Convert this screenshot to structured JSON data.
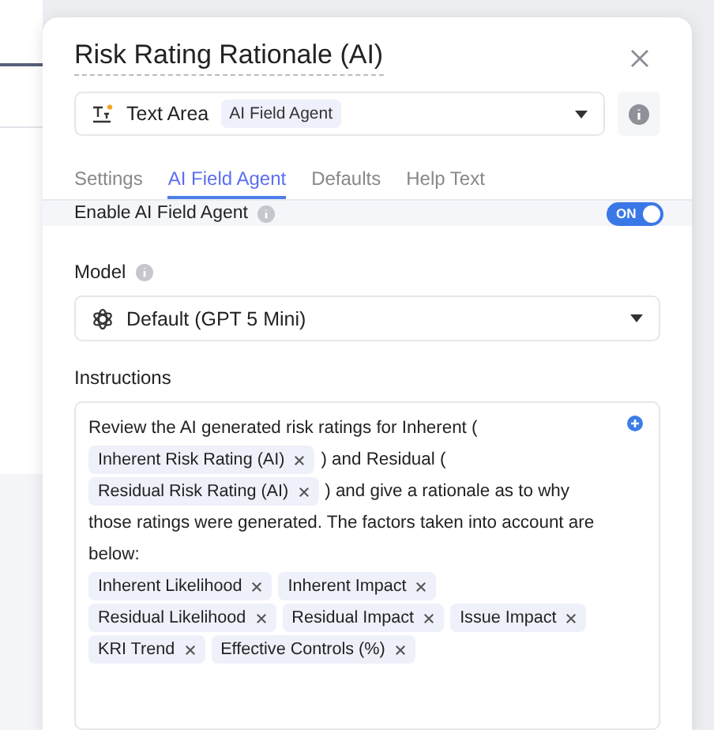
{
  "dialog": {
    "title": "Risk Rating Rationale (AI)",
    "field_type": {
      "label": "Text Area",
      "badge": "AI Field Agent"
    }
  },
  "tabs": [
    {
      "label": "Settings",
      "selected": false
    },
    {
      "label": "AI Field Agent",
      "selected": true
    },
    {
      "label": "Defaults",
      "selected": false
    },
    {
      "label": "Help Text",
      "selected": false
    }
  ],
  "enable_row": {
    "label": "Enable AI Field Agent",
    "toggle_text": "ON",
    "on": true
  },
  "model": {
    "label": "Model",
    "value": "Default (GPT 5 Mini)"
  },
  "instructions": {
    "label": "Instructions",
    "segments": [
      {
        "kind": "text",
        "text": "Review the AI generated risk ratings for Inherent ("
      },
      {
        "kind": "break"
      },
      {
        "kind": "chip",
        "text": "Inherent Risk Rating (AI)"
      },
      {
        "kind": "text",
        "text": ") and Residual ("
      },
      {
        "kind": "break"
      },
      {
        "kind": "chip",
        "text": "Residual Risk Rating (AI)"
      },
      {
        "kind": "text",
        "text": ") and give a rationale as to why"
      },
      {
        "kind": "break"
      },
      {
        "kind": "text",
        "text": "those ratings were generated. The factors taken into account are"
      },
      {
        "kind": "break"
      },
      {
        "kind": "text",
        "text": "below:"
      },
      {
        "kind": "break"
      },
      {
        "kind": "chip",
        "text": "Inherent Likelihood"
      },
      {
        "kind": "chip",
        "text": "Inherent Impact"
      },
      {
        "kind": "break"
      },
      {
        "kind": "chip",
        "text": "Residual Likelihood"
      },
      {
        "kind": "chip",
        "text": "Residual Impact"
      },
      {
        "kind": "chip",
        "text": "Issue Impact"
      },
      {
        "kind": "break"
      },
      {
        "kind": "chip",
        "text": "KRI Trend"
      },
      {
        "kind": "chip",
        "text": "Effective Controls (%)"
      }
    ]
  }
}
